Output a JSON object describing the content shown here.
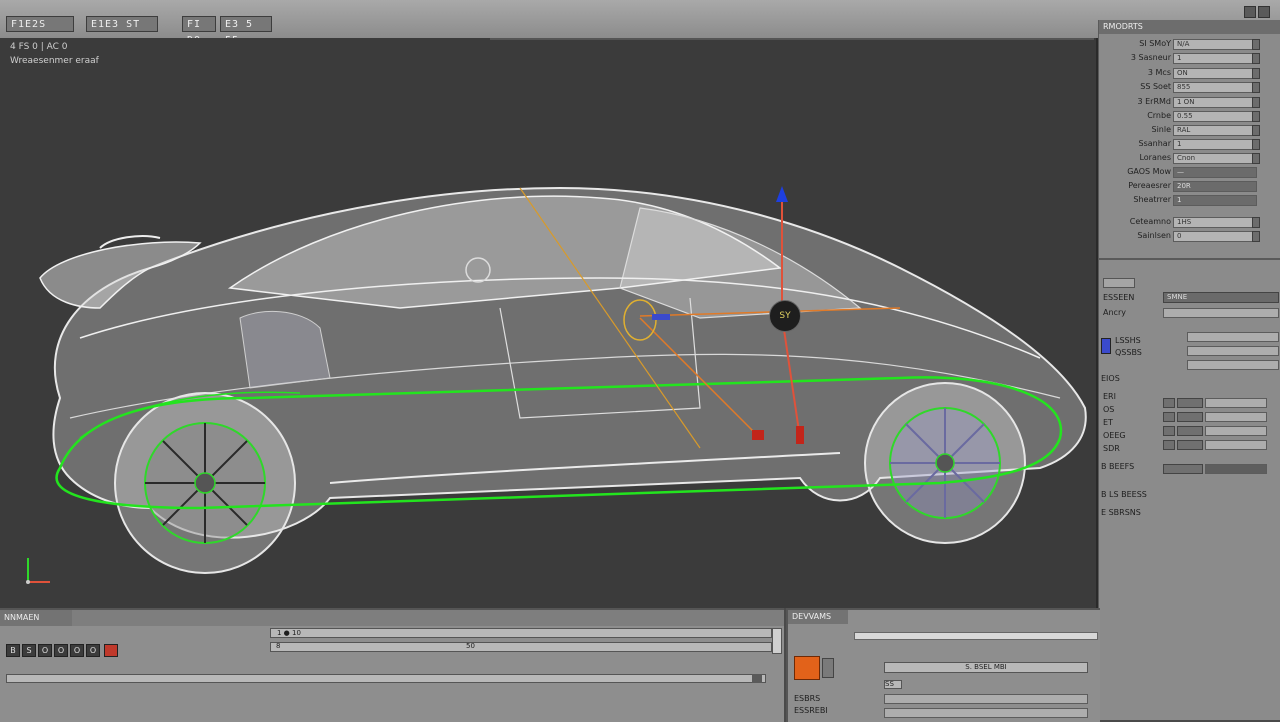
{
  "menu": {
    "items": [
      "F1E2S",
      "E1E3 ST",
      "FI DO",
      "E3 5 55"
    ]
  },
  "viewport": {
    "info_line_1": "4 FS 0 | AC 0",
    "info_line_2": "Wreaesenmer eraaf",
    "gizmo_label": "SY",
    "axis_colors": {
      "x": "#e0523a",
      "y": "#1e3fe0",
      "z": "#e0523a"
    },
    "spline_color": "#23e41e",
    "car_outline_color": "#e6e6e6"
  },
  "props": {
    "header": "RMODRTS",
    "rows": [
      {
        "label": "SI SMoY",
        "value": "N/A"
      },
      {
        "label": "3 Sasneur",
        "value": "1"
      },
      {
        "label": "3 Mcs",
        "value": "ON"
      },
      {
        "label": "SS Soet",
        "value": "855"
      },
      {
        "label": "3 ErRMd",
        "value": "1 ON"
      },
      {
        "label": "Crnbe",
        "value": "0.55"
      },
      {
        "label": "Sinle",
        "value": "RAL"
      },
      {
        "label": "Ssanhar",
        "value": "1"
      },
      {
        "label": "Loranes",
        "value": "Cnon"
      },
      {
        "label": "GAOS Mow",
        "value": "—"
      },
      {
        "label": "Pereaesrer",
        "value": "20R"
      },
      {
        "label": "Sheatrrer",
        "value": "1"
      },
      {
        "label": "Ceteamno",
        "value": "1HS"
      },
      {
        "label": "Sainlsen",
        "value": "0"
      }
    ],
    "section2": [
      {
        "label": "ESSEEN",
        "value": "SMNE"
      },
      {
        "label": "Ancry",
        "value": ""
      },
      {
        "label": "LSSHS",
        "value": ""
      },
      {
        "label": "QSSBS",
        "value": ""
      },
      {
        "label": "EIOS",
        "value": ""
      }
    ],
    "lower_rows": [
      "ERI",
      "OS",
      "ET",
      "OEEG",
      "SDR"
    ],
    "footer_1": "B BEEFS",
    "footer_2": "B LS BEESS",
    "footer_3": "E SBRSNS"
  },
  "timeline": {
    "title": "NNMAEN",
    "buttons": [
      "B",
      "S",
      "O",
      "O",
      "O",
      "O"
    ],
    "track_label_1": "1 ● 10",
    "track_label_2": "8",
    "track_label_3": "50"
  },
  "bottomright": {
    "label_1": "DEVVAMS",
    "field_1": "S. BSEL MBI",
    "label_2": "SS",
    "label_3": "ESBRS",
    "label_4": "ESSREBI"
  }
}
